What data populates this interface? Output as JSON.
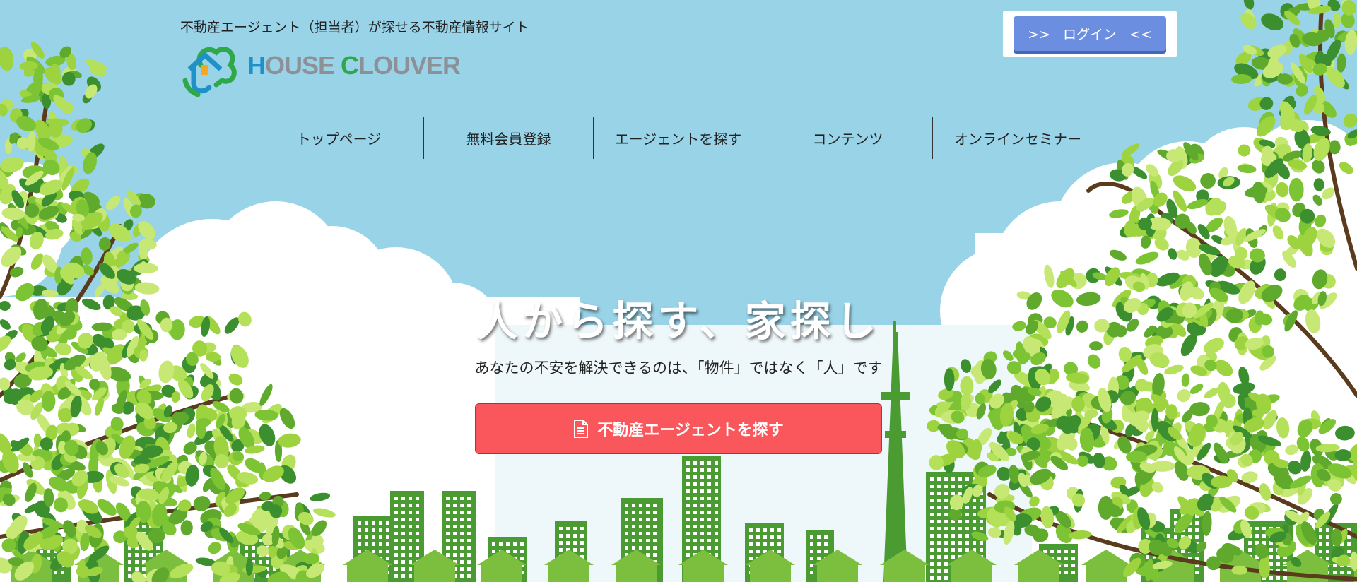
{
  "header": {
    "tagline": "不動産エージェント（担当者）が探せる不動産情報サイト",
    "logo": {
      "part1": "H",
      "part2": "OUSE ",
      "part3": "C",
      "part4": "LOUVER"
    },
    "login_label": ">>   ログイン   <<"
  },
  "nav": {
    "items": [
      {
        "label": "トップページ"
      },
      {
        "label": "無料会員登録"
      },
      {
        "label": "エージェントを探す"
      },
      {
        "label": "コンテンツ"
      },
      {
        "label": "オンラインセミナー"
      }
    ]
  },
  "hero": {
    "headline": "人から探す、家探し",
    "subline": "あなたの不安を解決できるのは、「物件」ではなく「人」です",
    "cta_label": "不動産エージェントを探す"
  },
  "colors": {
    "sky": "#99d3e7",
    "building": "#4b9b33",
    "leaf_light": "#9dd33f",
    "leaf_dark": "#3c8f2f",
    "cta": "#f9575b",
    "login": "#6b8ee0"
  },
  "icons": [
    "house-clover-logo-icon",
    "document-icon"
  ]
}
